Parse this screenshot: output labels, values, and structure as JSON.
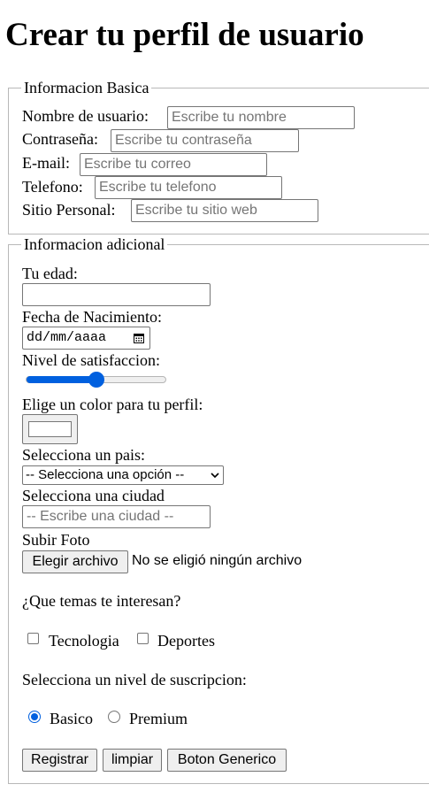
{
  "page_title": "Crear tu perfil de usuario",
  "basic": {
    "legend": "Informacion Basica",
    "fields": [
      {
        "label": "Nombre de usuario:",
        "placeholder": "Escribe tu nombre"
      },
      {
        "label": "Contraseña:",
        "placeholder": "Escribe tu contraseña"
      },
      {
        "label": "E-mail:",
        "placeholder": "Escribe tu correo"
      },
      {
        "label": "Telefono:",
        "placeholder": "Escribe tu telefono"
      },
      {
        "label": "Sitio Personal:",
        "placeholder": "Escribe tu sitio web"
      }
    ]
  },
  "additional": {
    "legend": "Informacion adicional",
    "age_label": "Tu edad:",
    "age_value": "",
    "birth_label": "Fecha de Nacimiento:",
    "birth_format": "dd/mm/aaaa",
    "satisfaction_label": "Nivel de satisfaccion:",
    "satisfaction_value": 0.5,
    "color_label": "Elige un color para tu perfil:",
    "color_value": "#ffffff",
    "country_label": "Selecciona un pais:",
    "country_selected": "-- Selecciona una opción --",
    "city_label": "Selecciona una ciudad",
    "city_placeholder": "-- Escribe una ciudad --",
    "photo_label": "Subir Foto",
    "file_button": "Elegir archivo",
    "file_status": "No se eligió ningún archivo",
    "topics_label": "¿Que temas te interesan?",
    "topics": [
      {
        "label": "Tecnologia",
        "checked": false
      },
      {
        "label": "Deportes",
        "checked": false
      }
    ],
    "subscription_label": "Selecciona un nivel de suscripcion:",
    "subscriptions": [
      {
        "label": "Basico",
        "selected": true
      },
      {
        "label": "Premium",
        "selected": false
      }
    ],
    "buttons": [
      "Registrar",
      "limpiar",
      "Boton Generico"
    ]
  },
  "colors": {
    "accent": "#0060df",
    "border": "#767676",
    "button_bg": "#efefef"
  },
  "icons": {
    "calendar": "calendar-icon",
    "dropdown": "chevron-down-icon"
  }
}
